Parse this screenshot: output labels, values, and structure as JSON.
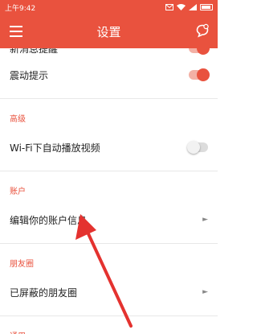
{
  "status_bar": {
    "time": "上午9:42"
  },
  "app_bar": {
    "title": "设置"
  },
  "settings": {
    "partial_top_label": "新消息提醒",
    "vibrate": {
      "label": "震动提示",
      "on": true
    },
    "advanced": {
      "header": "高级",
      "wifi_autoplay": {
        "label": "Wi-Fi下自动播放视频",
        "on": false
      }
    },
    "account": {
      "header": "账户",
      "edit_info": {
        "label": "编辑你的账户信息"
      }
    },
    "moments": {
      "header": "朋友圈",
      "blocked": {
        "label": "已屏蔽的朋友圈"
      }
    },
    "partial_bottom_header": "通用"
  },
  "colors": {
    "accent": "#e9523e",
    "arrow": "#e4322f"
  },
  "icons": {
    "menu": "menu-icon",
    "chat": "chat-bubble-icon",
    "chevron": "chevron-right-icon",
    "wifi": "wifi-icon",
    "signal": "signal-icon",
    "battery": "battery-icon"
  }
}
